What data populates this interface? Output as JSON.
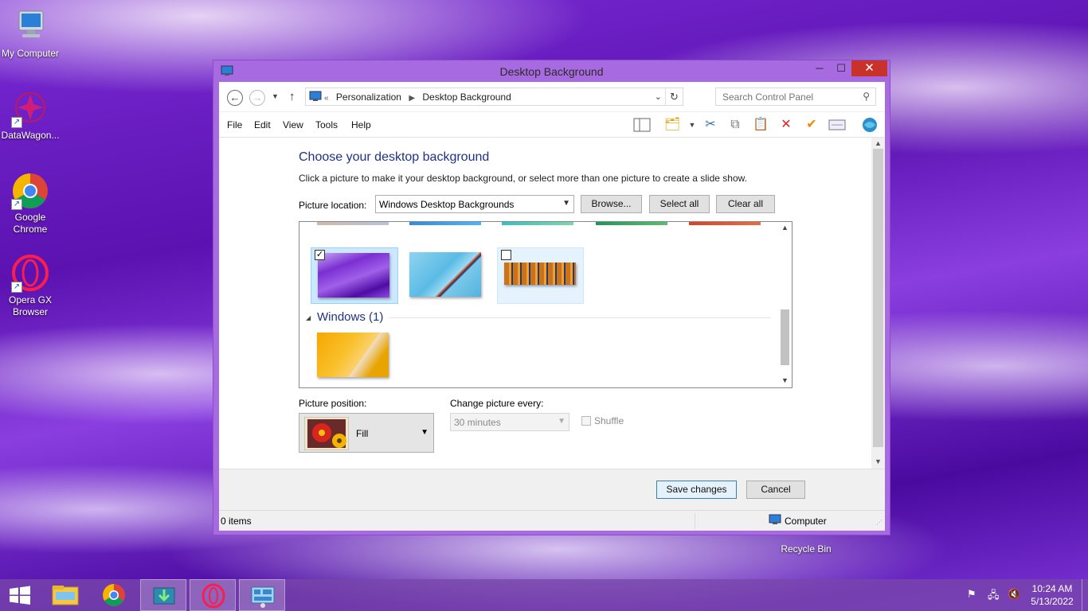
{
  "desktop": {
    "icons": [
      {
        "label": "My Computer"
      },
      {
        "label": "DataWagon..."
      },
      {
        "label": "Google Chrome"
      },
      {
        "label": "Opera GX Browser"
      },
      {
        "label": "Recycle Bin"
      }
    ]
  },
  "window": {
    "title": "Desktop Background",
    "controls": {
      "minimize": "─",
      "maximize": "☐",
      "close": "✕"
    }
  },
  "addressbar": {
    "overflow": "«",
    "crumbs": [
      "Personalization",
      "Desktop Background"
    ],
    "search_placeholder": "Search Control Panel"
  },
  "menubar": {
    "items": [
      "File",
      "Edit",
      "View",
      "Tools",
      "Help"
    ]
  },
  "page": {
    "heading": "Choose your desktop background",
    "subtext": "Click a picture to make it your desktop background, or select more than one picture to create a slide show.",
    "picture_location_label": "Picture location:",
    "picture_location_value": "Windows Desktop Backgrounds",
    "browse_label": "Browse...",
    "select_all_label": "Select all",
    "clear_all_label": "Clear all",
    "group_title": "Windows (1)",
    "picture_position_label": "Picture position:",
    "picture_position_value": "Fill",
    "change_picture_label": "Change picture every:",
    "change_picture_value": "30 minutes",
    "shuffle_label": "Shuffle"
  },
  "footer": {
    "save_label": "Save changes",
    "cancel_label": "Cancel"
  },
  "statusbar": {
    "items_count": "0 items",
    "location": "Computer"
  },
  "taskbar": {
    "time": "10:24 AM",
    "date": "5/13/2022"
  },
  "colors": {
    "heading": "#1e3287",
    "close_button": "#c9322a",
    "selection": "#cce8ff"
  }
}
